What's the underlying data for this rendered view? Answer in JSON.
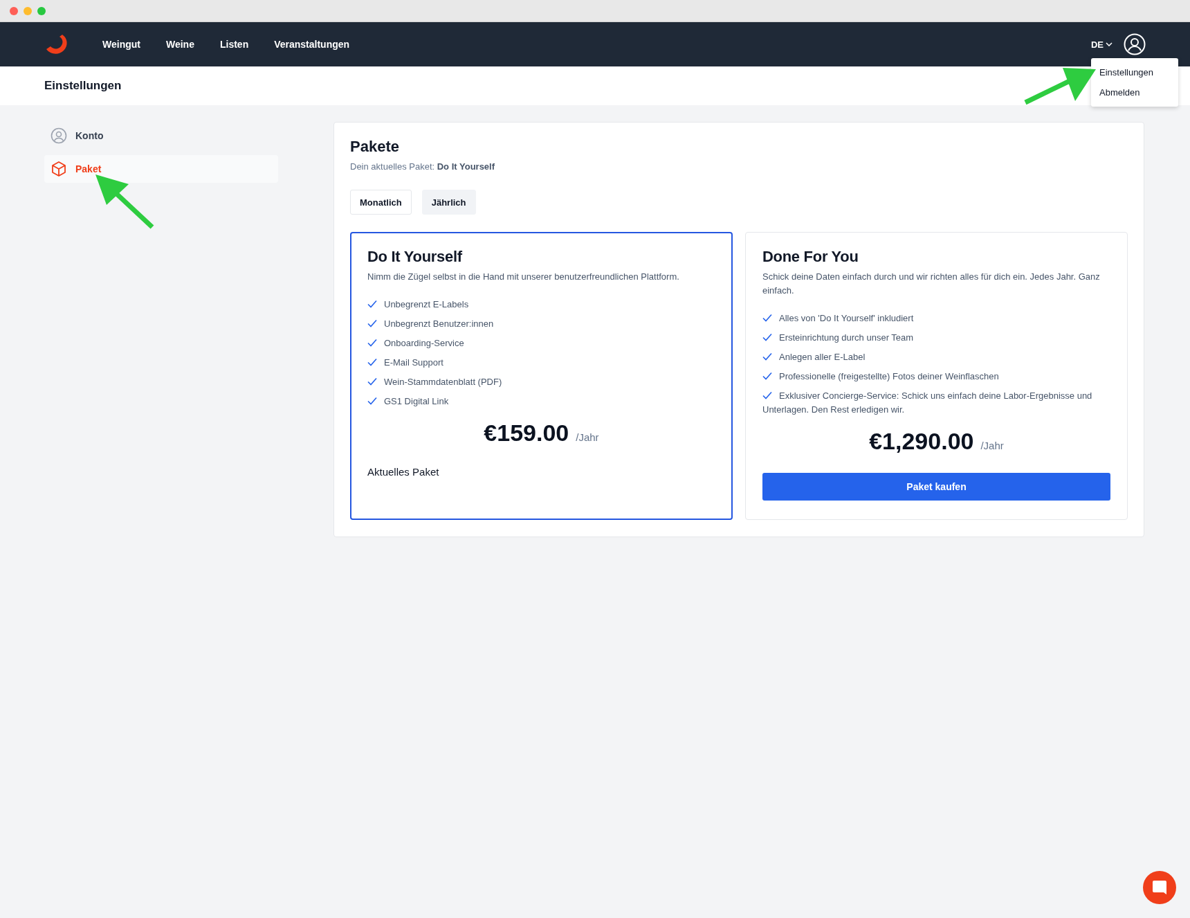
{
  "nav": {
    "items": [
      {
        "label": "Weingut"
      },
      {
        "label": "Weine"
      },
      {
        "label": "Listen"
      },
      {
        "label": "Veranstaltungen"
      }
    ],
    "language": "DE"
  },
  "user_menu": {
    "items": [
      {
        "label": "Einstellungen"
      },
      {
        "label": "Abmelden"
      }
    ]
  },
  "page_title": "Einstellungen",
  "sidebar": {
    "items": [
      {
        "label": "Konto",
        "kind": "account",
        "selected": false
      },
      {
        "label": "Paket",
        "kind": "package",
        "selected": true
      }
    ]
  },
  "packages": {
    "title": "Pakete",
    "current": "Dein aktuelles Paket: **Do It Yourself**",
    "tabs": [
      {
        "label": "Monatlich",
        "selected": false
      },
      {
        "label": "Jährlich",
        "selected": true
      }
    ],
    "plans": [
      {
        "name": "Do It Yourself",
        "description": "Nimm die Zügel selbst in die Hand mit unserer benutzerfreundlichen Plattform.",
        "current": true,
        "features": [
          "Unbegrenzt E-Labels",
          "Unbegrenzt Benutzer:innen",
          "Onboarding-Service",
          "E-Mail Support",
          "Wein-Stammdatenblatt (PDF)",
          "GS1 Digital Link"
        ],
        "price": "€159.00",
        "period": "/Jahr",
        "action": {
          "kind": "label",
          "text": "Aktuelles Paket"
        }
      },
      {
        "name": "Done For You",
        "description": "Schick deine Daten einfach durch und wir richten alles für dich ein. Jedes Jahr. Ganz einfach.",
        "current": false,
        "features": [
          "Alles von 'Do It Yourself' inkludiert",
          "Ersteinrichtung durch unser Team",
          "Anlegen aller E-Label",
          "Professionelle (freigestellte) Fotos deiner Weinflaschen",
          "Exklusiver Concierge-Service: Schick uns einfach deine Labor-Ergebnisse und Unterlagen. Den Rest erledigen wir."
        ],
        "price": "€1,290.00",
        "period": "/Jahr",
        "action": {
          "kind": "button",
          "text": "Paket kaufen"
        }
      }
    ]
  }
}
